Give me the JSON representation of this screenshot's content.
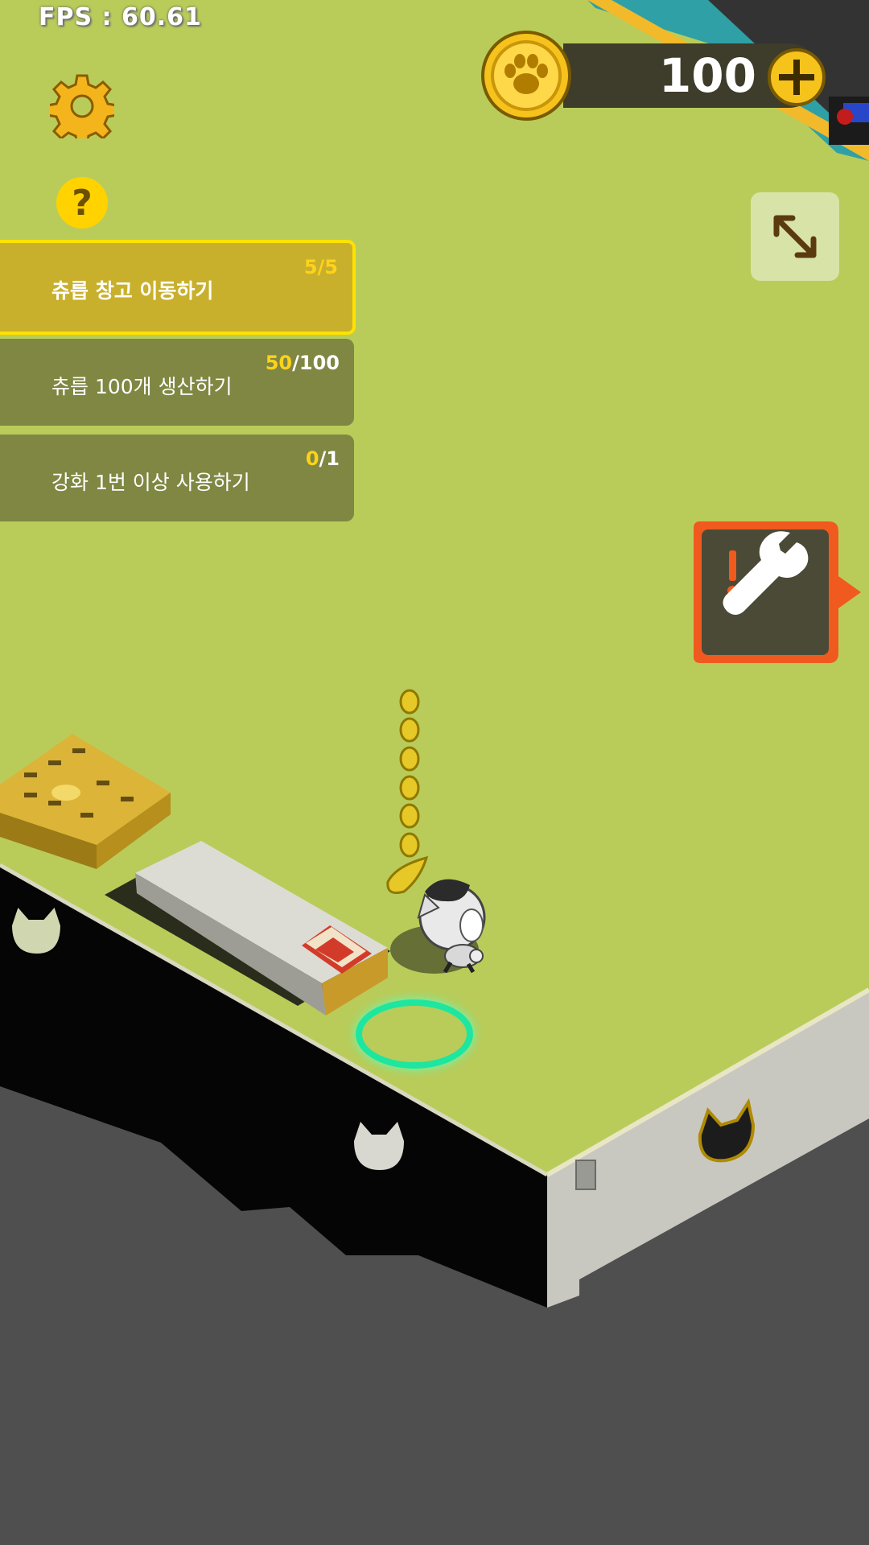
{
  "hud": {
    "fps_text": "FPS : 60.61",
    "coins": "100",
    "help_label": "?"
  },
  "icons": {
    "settings": "gear-icon",
    "help": "question-icon",
    "coin": "paw-coin-icon",
    "add_coins": "plus-icon",
    "expand": "expand-arrows-icon",
    "repair": "wrench-alert-icon"
  },
  "quests": [
    {
      "title": "츄릅 창고 이동하기",
      "current": "5",
      "total": "5",
      "active": true
    },
    {
      "title": "츄릅 100개 생산하기",
      "current": "50",
      "total": "100",
      "active": false
    },
    {
      "title": "강화 1번 이상 사용하기",
      "current": "0",
      "total": "1",
      "active": false
    }
  ],
  "colors": {
    "floor": "#b9cc5a",
    "accent_yellow": "#ffd200",
    "alert_orange": "#f05a1e",
    "ring": "#1de6a0"
  }
}
